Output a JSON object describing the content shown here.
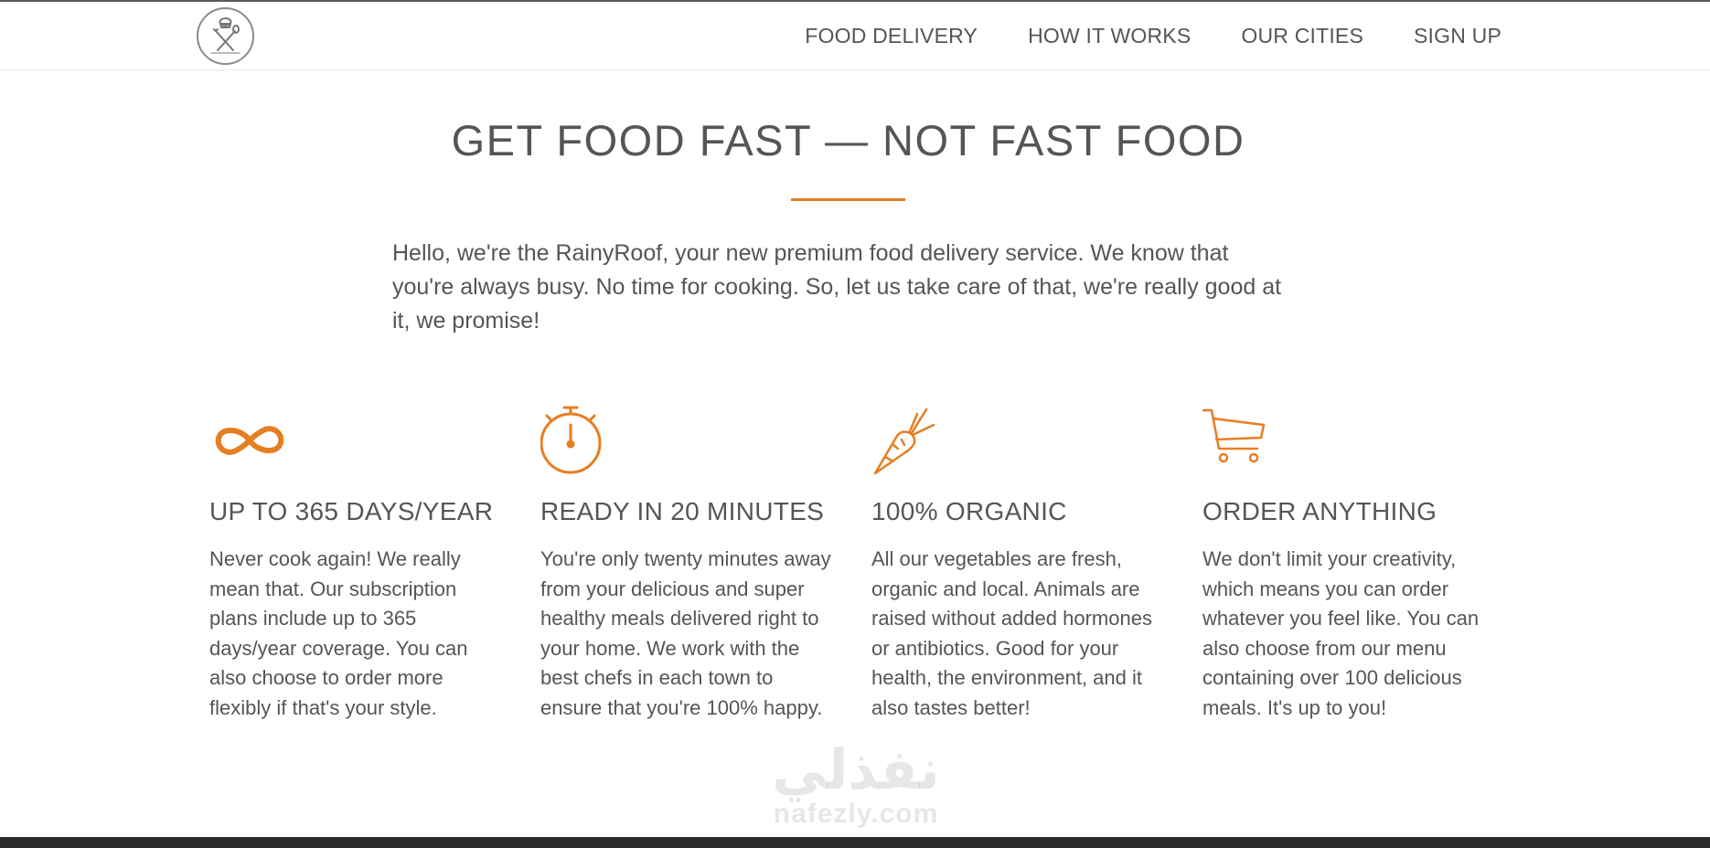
{
  "nav": {
    "logo_icon": "chef-utensils-logo-icon",
    "items": [
      {
        "label": "FOOD DELIVERY"
      },
      {
        "label": "HOW IT WORKS"
      },
      {
        "label": "OUR CITIES"
      },
      {
        "label": "SIGN UP"
      }
    ]
  },
  "hero": {
    "title": "GET FOOD FAST — NOT FAST FOOD",
    "intro": "Hello, we're the RainyRoof, your new premium food delivery service. We know that you're always busy. No time for cooking. So, let us take care of that, we're really good at it, we promise!"
  },
  "features": [
    {
      "icon": "infinity-icon",
      "title": "UP TO 365 DAYS/YEAR",
      "text": "Never cook again! We really mean that. Our subscription plans include up to 365 days/year coverage. You can also choose to order more flexibly if that's your style."
    },
    {
      "icon": "stopwatch-icon",
      "title": "READY IN 20 MINUTES",
      "text": "You're only twenty minutes away from your delicious and super healthy meals delivered right to your home. We work with the best chefs in each town to ensure that you're 100% happy."
    },
    {
      "icon": "carrot-icon",
      "title": "100% ORGANIC",
      "text": "All our vegetables are fresh, organic and local. Animals are raised without added hormones or antibiotics. Good for your health, the environment, and it also tastes better!"
    },
    {
      "icon": "shopping-cart-icon",
      "title": "ORDER ANYTHING",
      "text": "We don't limit your creativity, which means you can order whatever you feel like. You can also choose from our menu containing over 100 delicious meals. It's up to you!"
    }
  ],
  "watermark": {
    "arabic": "نفذلي",
    "latin": "nafezly.com"
  },
  "colors": {
    "accent": "#e67e22",
    "text": "#555555",
    "background": "#ffffff"
  }
}
